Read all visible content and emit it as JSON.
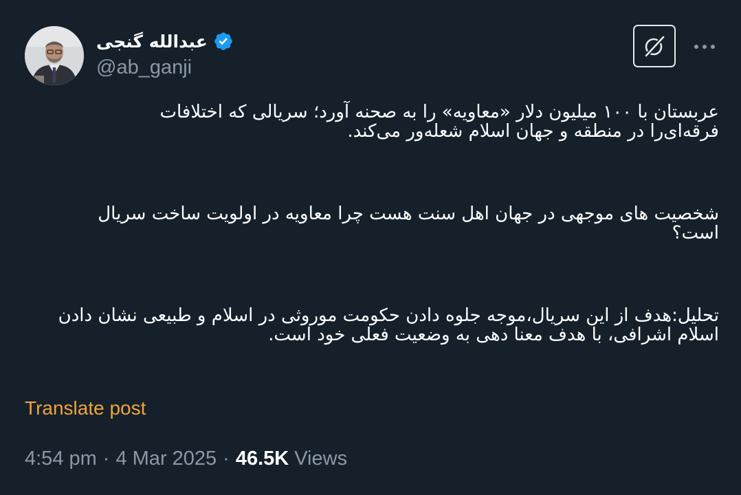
{
  "author": {
    "display_name": "عبدالله گنجی",
    "handle": "@ab_ganji",
    "verified": true,
    "avatar_icon": "profile-photo"
  },
  "actions": {
    "grok_icon": "grok-icon",
    "more_icon": "more-horizontal-icon"
  },
  "tweet": {
    "paragraphs": [
      "عربستان با ۱۰۰ میلیون دلار «معاویه» را به صحنه آورد؛ سریالی که اختلافات\nفرقه‌ای‌را در منطقه و جهان اسلام شعله‌ور می‌کند.",
      "شخصیت های موجهی در جهان اهل سنت هست چرا معاویه در اولویت ساخت سریال\nاست؟",
      "تحلیل:هدف از این سریال،موجه جلوه دادن حکومت موروثی در اسلام و طبیعی نشان دادن\nاسلام اشرافی، با هدف معنا دهی به وضعیت فعلی خود است."
    ],
    "translate_label": "Translate post",
    "time": "4:54 pm",
    "separator": "·",
    "date": "4 Mar 2025",
    "views_count": "46.5K",
    "views_label": "Views"
  },
  "colors": {
    "background": "#15202b",
    "text": "#ffffff",
    "secondary_text": "#8b98a5",
    "translate_link": "#f0a33d",
    "verified_badge": "#1d9bf0"
  }
}
